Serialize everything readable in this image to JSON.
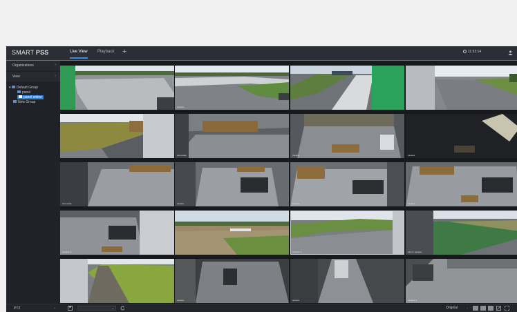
{
  "app": {
    "brand_main": "SMART ",
    "brand_bold": "PSS",
    "tabs": [
      {
        "label": "Live View",
        "active": true
      },
      {
        "label": "Playback",
        "active": false
      }
    ],
    "clock": "11:53:14"
  },
  "sidebar": {
    "organizations": "Organizations",
    "view": "View",
    "tree": {
      "default_group": "Default Group",
      "panel": "panel",
      "panel_online": "panel online",
      "new_group": "New Group"
    }
  },
  "cameras": [
    {
      "label": ""
    },
    {
      "label": "camera"
    },
    {
      "label": ""
    },
    {
      "label": ""
    },
    {
      "label": ""
    },
    {
      "label": "cam-scale"
    },
    {
      "label": "camera"
    },
    {
      "label": "camera"
    },
    {
      "label": "cam-scale"
    },
    {
      "label": "camera"
    },
    {
      "label": "camera"
    },
    {
      "label": "camera"
    },
    {
      "label": "camera m"
    },
    {
      "label": ""
    },
    {
      "label": "camera m"
    },
    {
      "label": "cam m camera"
    },
    {
      "label": ""
    },
    {
      "label": "camera"
    },
    {
      "label": "camera"
    },
    {
      "label": "camera m"
    }
  ],
  "bottombar": {
    "ptz": "PTZ",
    "select_value": "",
    "stream": "Original"
  },
  "colors": {
    "accent": "#2f7fd6",
    "background": "#1e2126"
  }
}
